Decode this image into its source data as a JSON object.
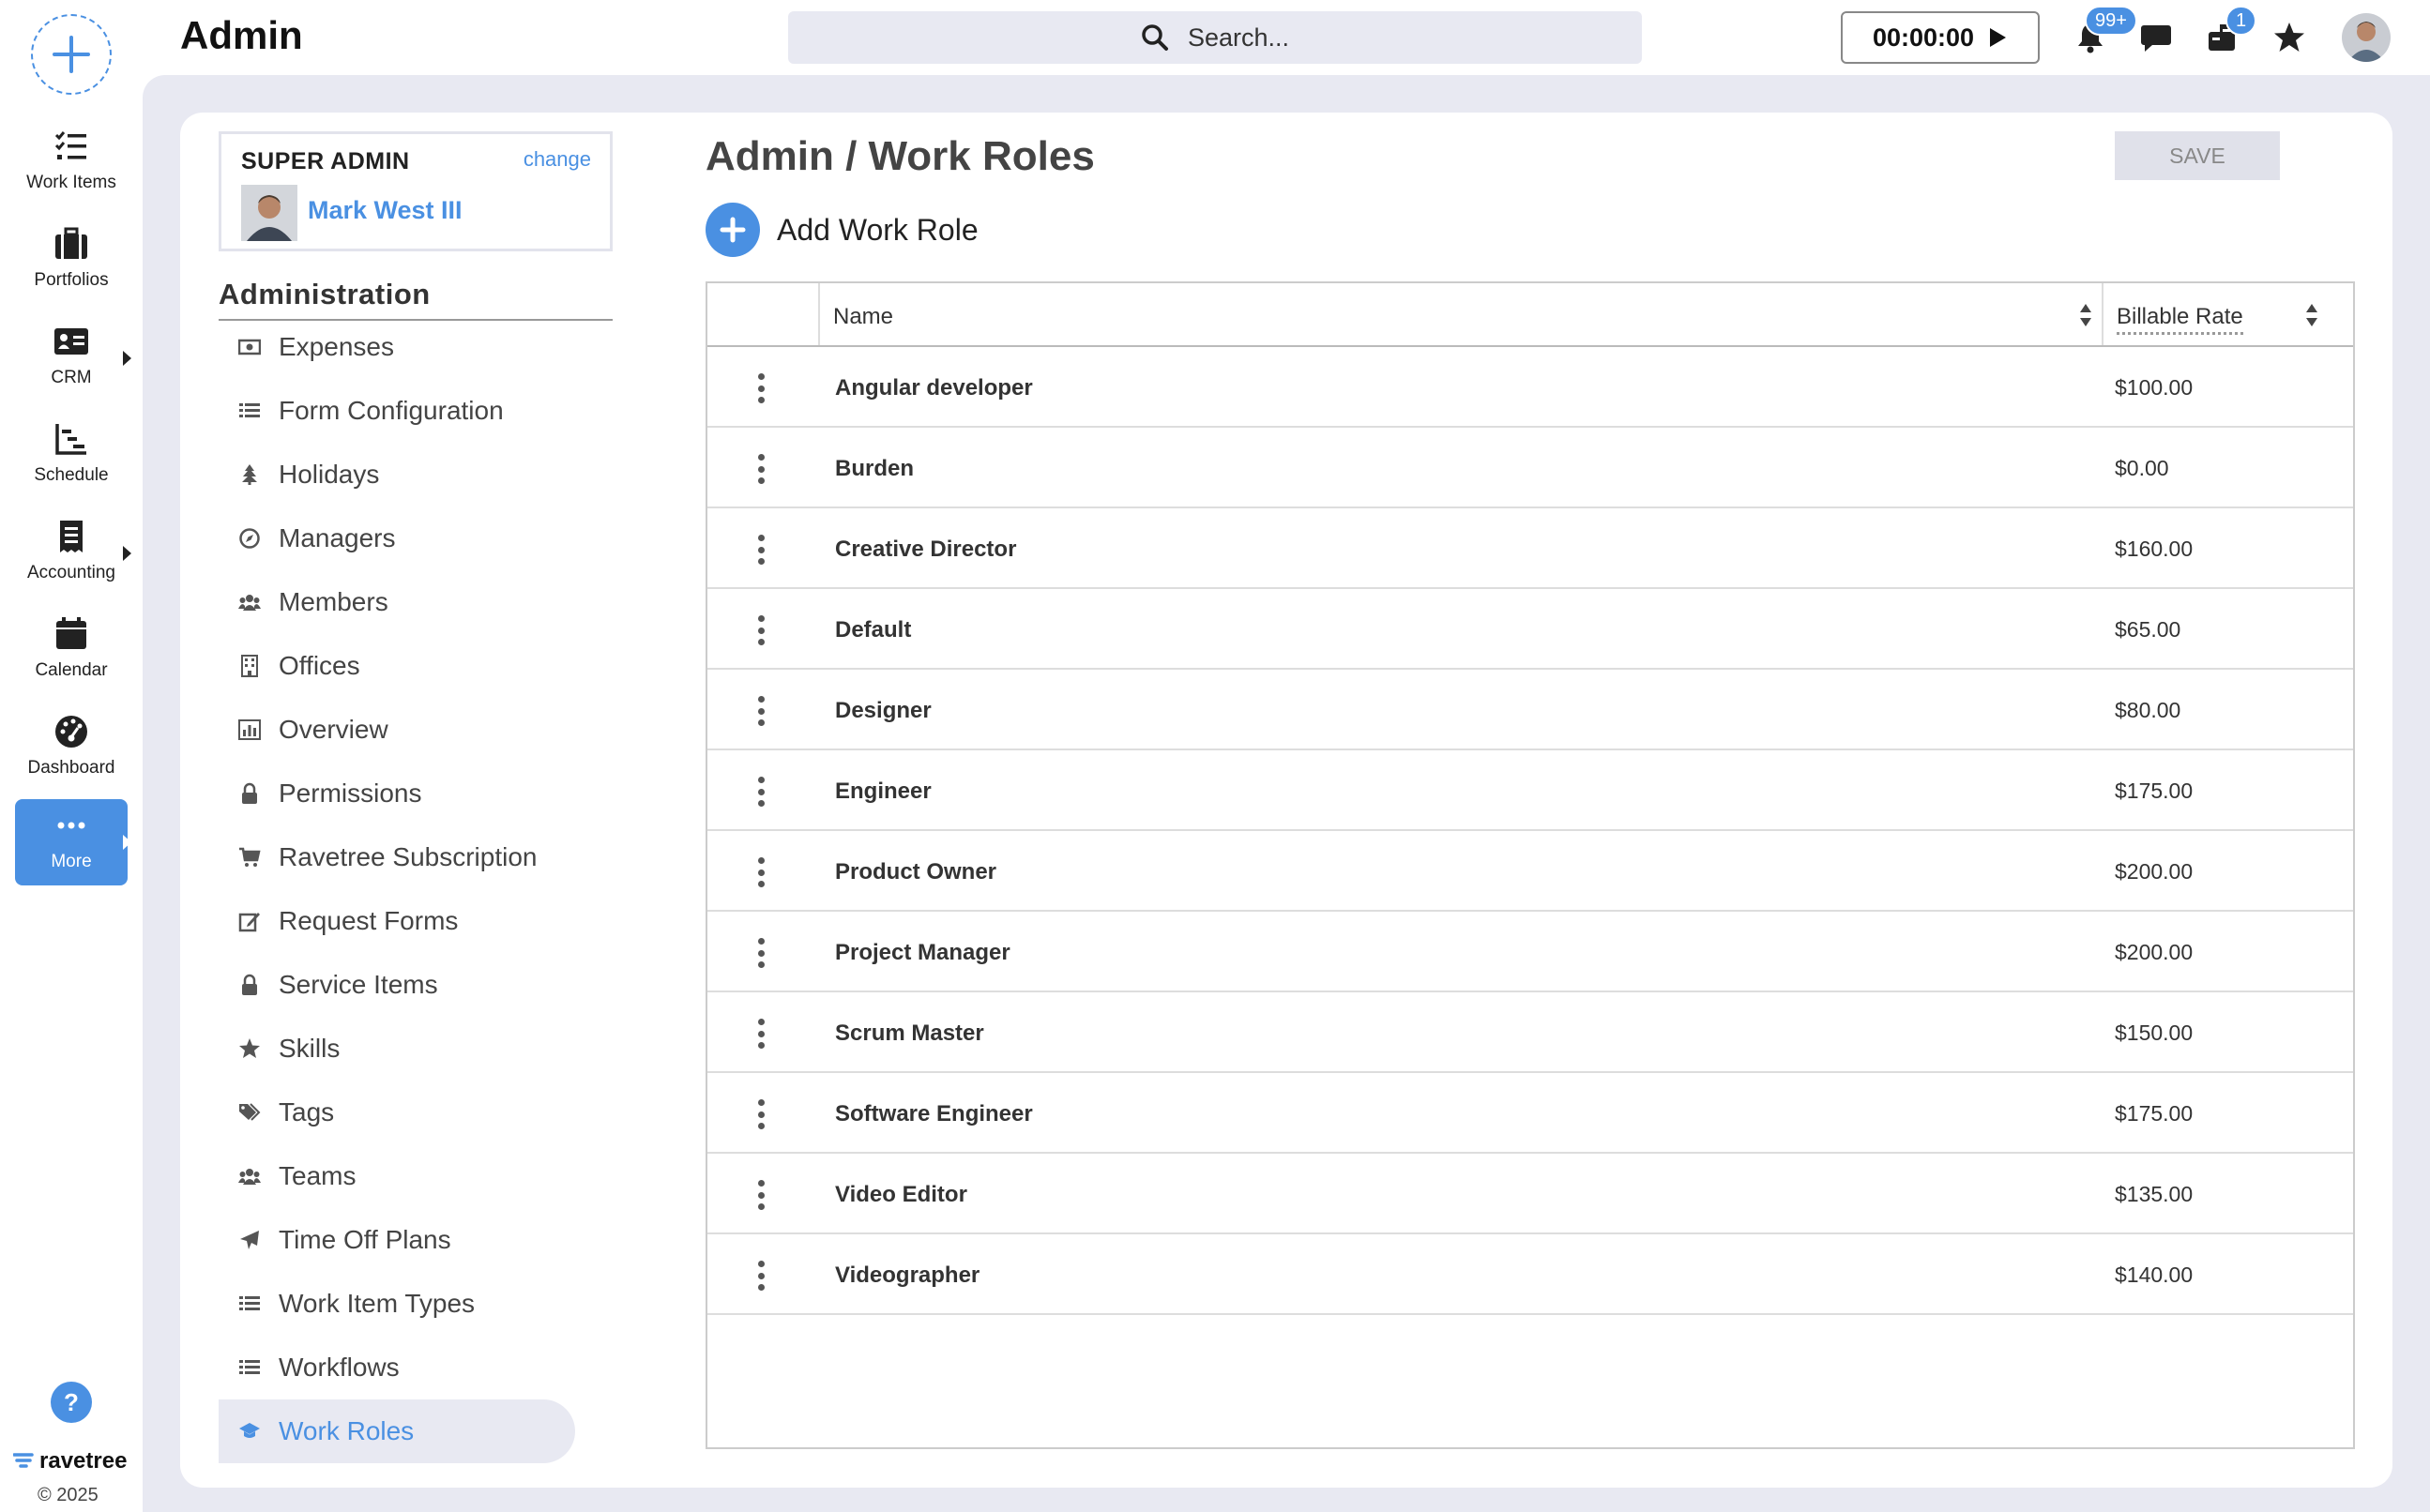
{
  "app": {
    "title": "Admin"
  },
  "rail": {
    "items": [
      {
        "label": "Work Items",
        "icon": "work-items-icon"
      },
      {
        "label": "Portfolios",
        "icon": "briefcase-icon"
      },
      {
        "label": "CRM",
        "icon": "contact-card-icon"
      },
      {
        "label": "Schedule",
        "icon": "schedule-chart-icon"
      },
      {
        "label": "Accounting",
        "icon": "receipt-icon"
      },
      {
        "label": "Calendar",
        "icon": "calendar-icon"
      },
      {
        "label": "Dashboard",
        "icon": "gauge-icon"
      },
      {
        "label": "More",
        "icon": "ellipsis-icon"
      }
    ],
    "help": "?",
    "brand": "ravetree",
    "copyright": "© 2025"
  },
  "topbar": {
    "search_placeholder": "Search...",
    "timer": "00:00:00",
    "notifications_badge": "99+",
    "inbox_badge": "1"
  },
  "user": {
    "role": "SUPER ADMIN",
    "change_label": "change",
    "name": "Mark West III"
  },
  "admin_nav": {
    "heading": "Administration",
    "items": [
      {
        "label": "Expenses",
        "icon": "money-icon"
      },
      {
        "label": "Form Configuration",
        "icon": "list-icon"
      },
      {
        "label": "Holidays",
        "icon": "tree-icon"
      },
      {
        "label": "Managers",
        "icon": "compass-icon"
      },
      {
        "label": "Members",
        "icon": "users-icon"
      },
      {
        "label": "Offices",
        "icon": "building-icon"
      },
      {
        "label": "Overview",
        "icon": "bar-chart-icon"
      },
      {
        "label": "Permissions",
        "icon": "lock-icon"
      },
      {
        "label": "Ravetree Subscription",
        "icon": "cart-icon"
      },
      {
        "label": "Request Forms",
        "icon": "edit-icon"
      },
      {
        "label": "Service Items",
        "icon": "lock-icon"
      },
      {
        "label": "Skills",
        "icon": "star-icon"
      },
      {
        "label": "Tags",
        "icon": "tags-icon"
      },
      {
        "label": "Teams",
        "icon": "users-icon"
      },
      {
        "label": "Time Off Plans",
        "icon": "plane-icon"
      },
      {
        "label": "Work Item Types",
        "icon": "list-icon"
      },
      {
        "label": "Workflows",
        "icon": "list-icon"
      },
      {
        "label": "Work Roles",
        "icon": "graduation-cap-icon"
      }
    ],
    "active": "Work Roles"
  },
  "main": {
    "title": "Admin / Work Roles",
    "save_label": "SAVE",
    "add_label": "Add Work Role",
    "columns": {
      "name": "Name",
      "rate": "Billable Rate"
    },
    "rows": [
      {
        "name": "Angular developer",
        "rate": "$100.00"
      },
      {
        "name": "Burden",
        "rate": "$0.00"
      },
      {
        "name": "Creative Director",
        "rate": "$160.00"
      },
      {
        "name": "Default",
        "rate": "$65.00"
      },
      {
        "name": "Designer",
        "rate": "$80.00"
      },
      {
        "name": "Engineer",
        "rate": "$175.00"
      },
      {
        "name": "Product Owner",
        "rate": "$200.00"
      },
      {
        "name": "Project Manager",
        "rate": "$200.00"
      },
      {
        "name": "Scrum Master",
        "rate": "$150.00"
      },
      {
        "name": "Software Engineer",
        "rate": "$175.00"
      },
      {
        "name": "Video Editor",
        "rate": "$135.00"
      },
      {
        "name": "Videographer",
        "rate": "$140.00"
      }
    ]
  },
  "colors": {
    "accent": "#4a90e2",
    "shell": "#e8e9f2"
  }
}
